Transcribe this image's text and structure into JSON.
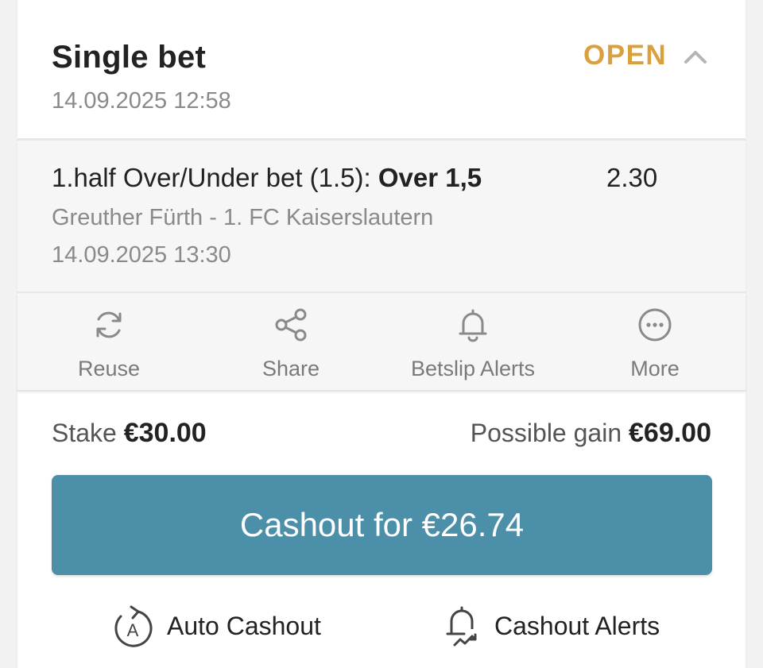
{
  "bet": {
    "title": "Single bet",
    "placed_at": "14.09.2025 12:58",
    "status": "OPEN",
    "status_color": "#d9a03f"
  },
  "selection": {
    "market_prefix": "1.half Over/Under bet (1.5): ",
    "market_pick": "Over 1,5",
    "odds": "2.30",
    "match": "Greuther Fürth - 1. FC Kaiserslautern",
    "match_time": "14.09.2025 13:30"
  },
  "actions": [
    {
      "label": "Reuse",
      "icon": "refresh-icon"
    },
    {
      "label": "Share",
      "icon": "share-icon"
    },
    {
      "label": "Betslip Alerts",
      "icon": "bell-icon"
    },
    {
      "label": "More",
      "icon": "more-icon"
    }
  ],
  "summary": {
    "stake_label": "Stake",
    "stake_value": "€30.00",
    "gain_label": "Possible gain",
    "gain_value": "€69.00"
  },
  "cashout": {
    "label": "Cashout for €26.74",
    "color": "#4c8fa9"
  },
  "bottom": {
    "auto_cashout_label": "Auto Cashout",
    "cashout_alerts_label": "Cashout Alerts"
  }
}
